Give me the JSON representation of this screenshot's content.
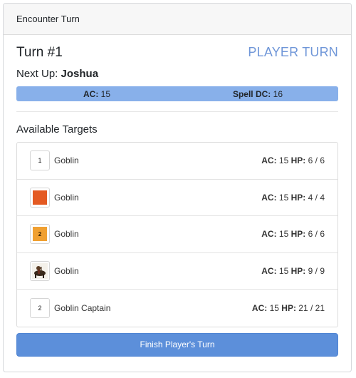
{
  "header": {
    "title": "Encounter Turn"
  },
  "turn": {
    "title": "Turn #1",
    "status": "PLAYER TURN",
    "next_up_label": "Next Up:",
    "next_up_name": "Joshua"
  },
  "player_stats": {
    "ac_label": "AC:",
    "ac_value": "15",
    "spell_dc_label": "Spell DC:",
    "spell_dc_value": "16"
  },
  "targets": {
    "title": "Available Targets",
    "ac_label": "AC:",
    "hp_label": "HP:",
    "items": [
      {
        "name": "Goblin",
        "token": "1",
        "token_style": "plain",
        "ac": "15",
        "hp": "6 / 6"
      },
      {
        "name": "Goblin",
        "token": "",
        "token_style": "orange",
        "ac": "15",
        "hp": "4 / 4"
      },
      {
        "name": "Goblin",
        "token": "2",
        "token_style": "amber",
        "ac": "15",
        "hp": "6 / 6"
      },
      {
        "name": "Goblin",
        "token": "",
        "token_style": "portrait",
        "ac": "15",
        "hp": "9 / 9"
      },
      {
        "name": "Goblin Captain",
        "token": "2",
        "token_style": "plain",
        "ac": "15",
        "hp": "21 / 21"
      }
    ]
  },
  "actions": {
    "finish_label": "Finish Player's Turn"
  },
  "colors": {
    "accent": "#6f96d8",
    "stats_bar": "#88b0ea",
    "button": "#5c8fda",
    "token_orange": "#e45a22",
    "token_amber": "#f0a031"
  }
}
